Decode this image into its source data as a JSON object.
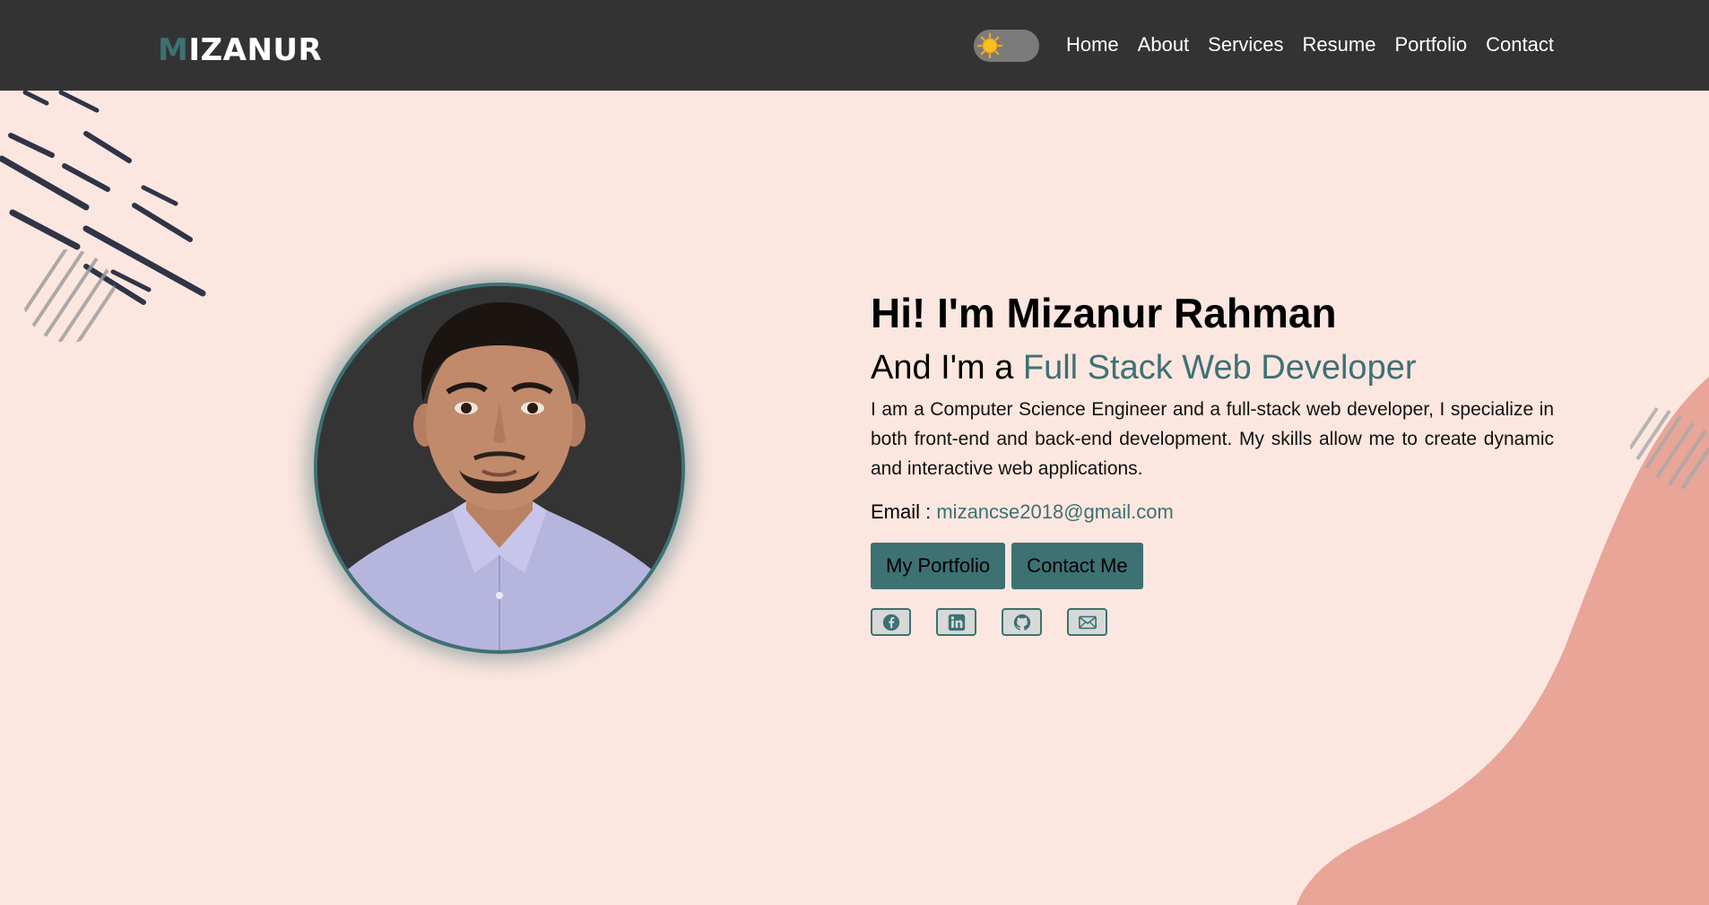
{
  "nav": {
    "logo_first": "M",
    "logo_rest": "IZANUR",
    "theme_toggle_icon": "sun-icon",
    "links": [
      "Home",
      "About",
      "Services",
      "Resume",
      "Portfolio",
      "Contact"
    ]
  },
  "hero": {
    "title": "Hi! I'm Mizanur Rahman",
    "subtitle_prefix": "And I'm a ",
    "subtitle_role": "Full Stack Web Developer",
    "description": "I am a Computer Science Engineer and a full-stack web developer, I specialize in both front-end and back-end development. My skills allow me to create dynamic and interactive web applications.",
    "email_label": "Email : ",
    "email_value": "mizancse2018@gmail.com",
    "buttons": [
      "My Portfolio",
      "Contact Me"
    ],
    "socials": [
      "facebook-icon",
      "linkedin-icon",
      "github-icon",
      "mail-icon"
    ]
  },
  "colors": {
    "accent": "#3d7174",
    "navbar": "#333333",
    "background": "#fce6e0",
    "wave": "#e8a598"
  }
}
